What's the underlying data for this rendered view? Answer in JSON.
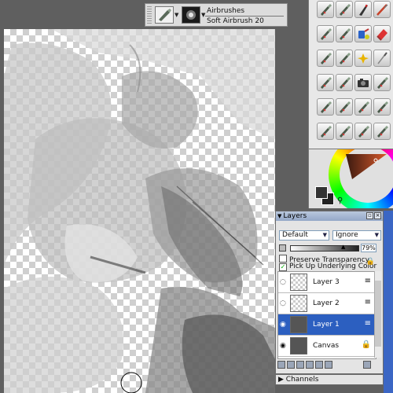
{
  "brush_selector": {
    "category": "Airbrushes",
    "variant": "Soft Airbrush 20"
  },
  "brush_palette": {
    "icons": [
      "airbrush-icon",
      "airbrush-icon",
      "pen-icon",
      "palette-knife-icon",
      "airbrush-icon",
      "airbrush-icon",
      "paint-bucket-icon",
      "eraser-icon",
      "airbrush-icon",
      "airbrush-icon",
      "sparkle-icon",
      "pencil-icon",
      "airbrush-icon",
      "airbrush-icon",
      "camera-icon",
      "airbrush-icon",
      "airbrush-icon",
      "airbrush-icon",
      "airbrush-icon",
      "airbrush-icon",
      "airbrush-icon",
      "airbrush-icon",
      "airbrush-icon",
      "airbrush-icon"
    ]
  },
  "layers_panel": {
    "title": "Layers",
    "composite_method": "Default",
    "composite_depth": "Ignore",
    "opacity": "79%",
    "opacity_value": 0.79,
    "preserve_transparency_label": "Preserve Transparency",
    "preserve_transparency_checked": false,
    "pick_up_color_label": "Pick Up Underlying Color",
    "pick_up_color_checked": true,
    "layers": [
      {
        "name": "Layer 3",
        "visible": false,
        "selected": false
      },
      {
        "name": "Layer 2",
        "visible": false,
        "selected": false
      },
      {
        "name": "Layer 1",
        "visible": true,
        "selected": true
      },
      {
        "name": "Canvas",
        "visible": true,
        "selected": false
      }
    ]
  },
  "channels_panel": {
    "title": "Channels"
  },
  "colors": {
    "workspace": "#5f5f5f",
    "selection": "#2c5fc0",
    "title_bar": "#94a8c8"
  }
}
